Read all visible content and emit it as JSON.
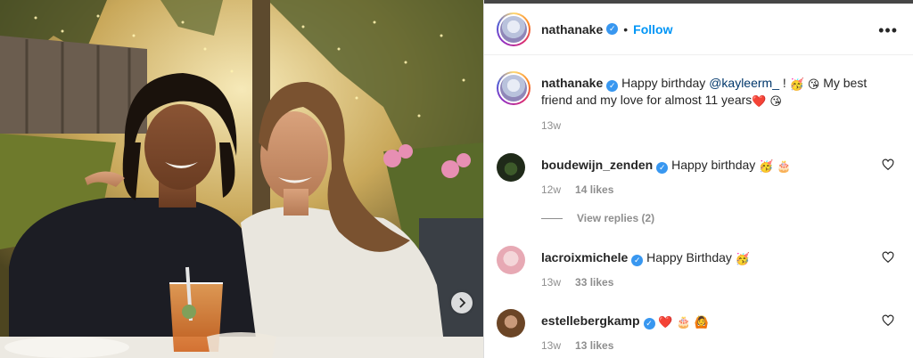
{
  "post": {
    "author": "nathanake",
    "follow_label": "Follow",
    "separator": "•",
    "more_label": "•••"
  },
  "caption": {
    "username": "nathanake",
    "text_before": "Happy birthday ",
    "mention": "@kayleerm_",
    "text_after": " ! ",
    "text_line2": "My best friend and my love for almost 11 years",
    "time": "13w"
  },
  "comments": [
    {
      "username": "boudewijn_zenden",
      "verified": true,
      "text": "Happy birthday",
      "time": "12w",
      "likes": "14 likes",
      "view_replies": "View replies (2)"
    },
    {
      "username": "lacroixmichele",
      "verified": true,
      "text": "Happy Birthday",
      "time": "13w",
      "likes": "33 likes"
    },
    {
      "username": "estellebergkamp",
      "verified": true,
      "text": "",
      "time": "13w",
      "likes": "13 likes"
    }
  ],
  "icons": {
    "verified": "verified-badge-icon",
    "heart": "heart-outline-icon",
    "next": "chevron-right-icon",
    "more": "more-options-icon"
  },
  "colors": {
    "accent": "#0095f6",
    "verified": "#3897f0",
    "muted": "#8e8e8e"
  }
}
